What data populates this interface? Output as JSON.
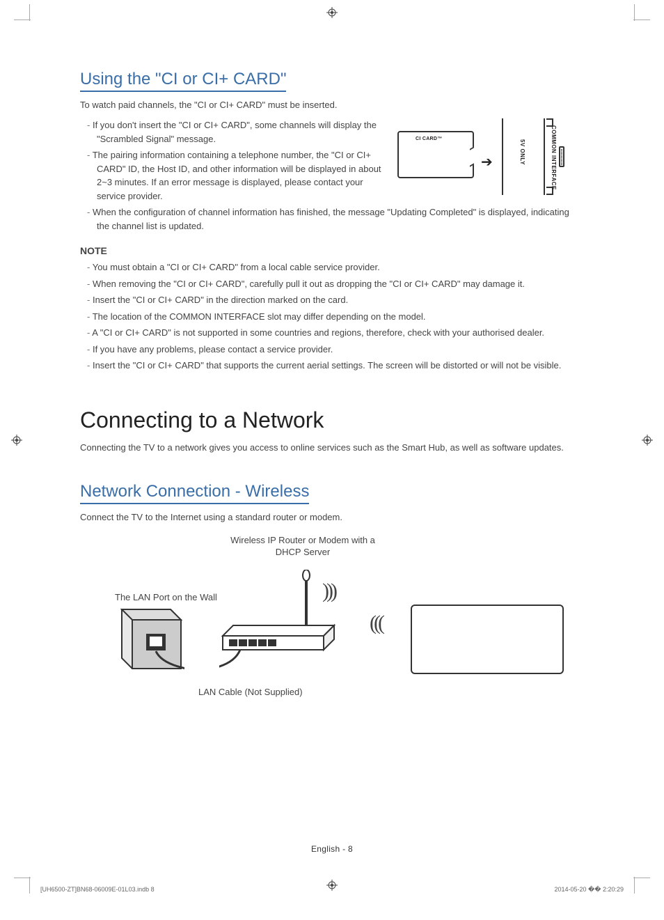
{
  "ci_section": {
    "title": "Using the \"CI or CI+ CARD\"",
    "intro": "To watch paid channels, the \"CI or CI+ CARD\" must be inserted.",
    "bullets_top": [
      "If you don't insert the \"CI or CI+ CARD\", some channels will display the \"Scrambled Signal\" message.",
      "The pairing information containing a telephone number, the \"CI or CI+ CARD\" ID, the Host ID, and other information will be displayed in about 2~3 minutes. If an error message is displayed, please contact your service provider."
    ],
    "bullet_full": "When the configuration of channel information has finished, the message \"Updating Completed\" is displayed, indicating the channel list is updated.",
    "note_heading": "NOTE",
    "note_bullets": [
      "You must obtain a \"CI or CI+ CARD\" from a local cable service provider.",
      "When removing the \"CI or CI+ CARD\", carefully pull it out as dropping the \"CI or CI+ CARD\" may damage it.",
      "Insert the \"CI or CI+ CARD\" in the direction marked on the card.",
      "The location of the COMMON INTERFACE slot may differ depending on the model.",
      "A \"CI or CI+ CARD\" is not supported in some countries and regions, therefore, check with your authorised dealer.",
      "If you have any problems, please contact a service provider.",
      "Insert the \"CI or CI+ CARD\" that supports the current aerial settings. The screen will be distorted or will not be visible."
    ],
    "diagram": {
      "card_label": "CI CARD™",
      "slot_label": "COMMON INTERFACE",
      "power_label": "5V ONLY"
    }
  },
  "network_section": {
    "main_title": "Connecting to a Network",
    "intro": "Connecting the TV to a network gives you access to online services such as the Smart Hub, as well as software updates.",
    "wireless_title": "Network Connection - Wireless",
    "wireless_intro": "Connect the TV to the Internet using a standard router or modem.",
    "diagram": {
      "router_label": "Wireless IP Router or Modem with a DHCP Server",
      "lan_wall_label": "The LAN Port on the Wall",
      "lan_cable_label": "LAN Cable (Not Supplied)"
    }
  },
  "footer": {
    "page_label": "English - 8"
  },
  "print_marks": {
    "file_info": "[UH6500-ZT]BN68-06009E-01L03.indb   8",
    "timestamp": "2014-05-20   �� 2:20:29"
  }
}
